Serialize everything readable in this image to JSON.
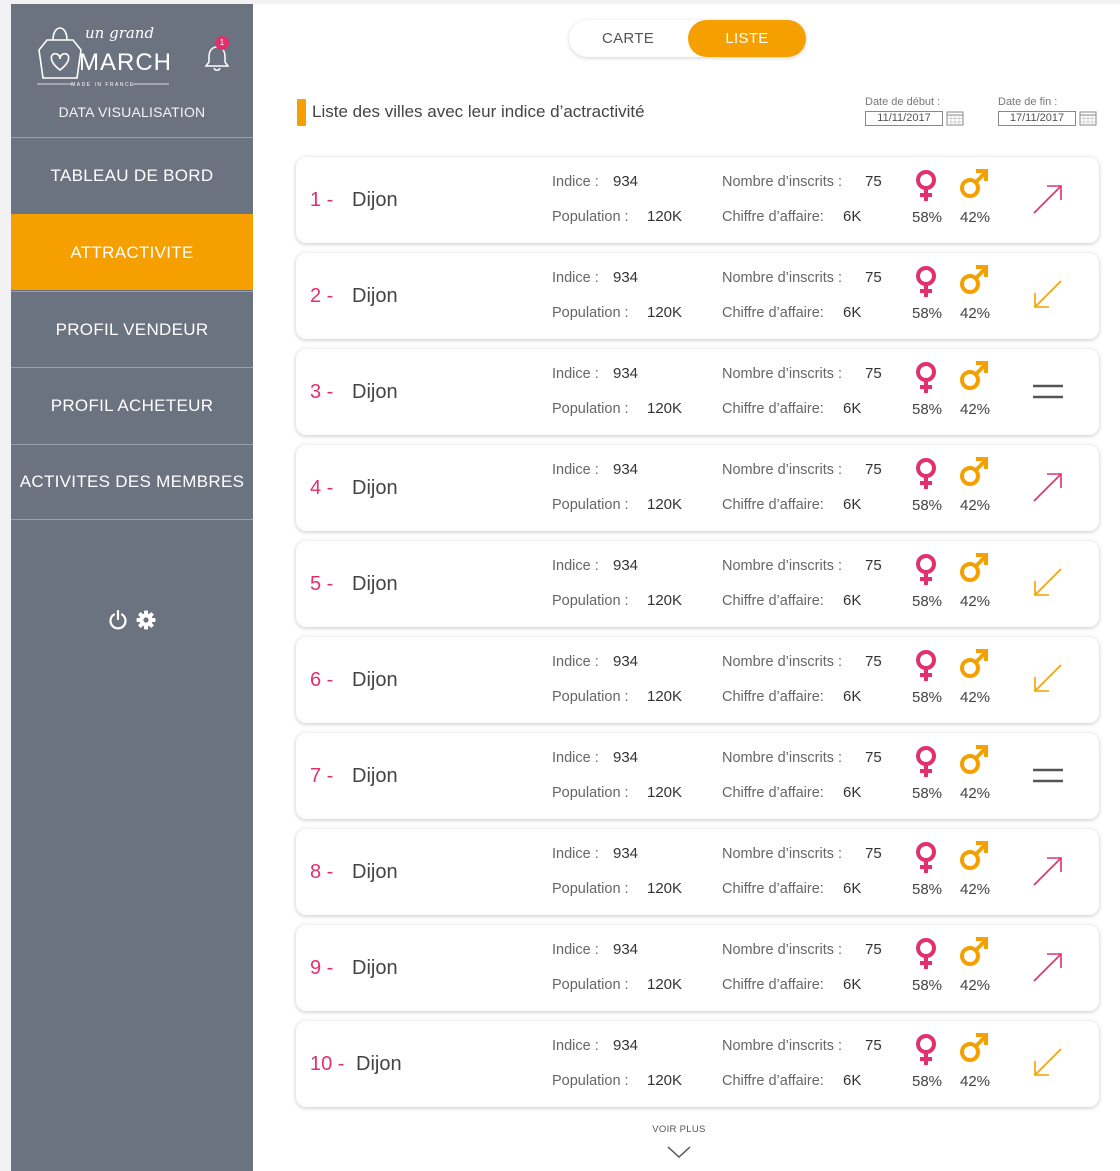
{
  "brand": {
    "line1": "un grand",
    "line2": "MARCHÉ",
    "tagline": "MADE IN FRANCE"
  },
  "notifications": {
    "count": "1"
  },
  "sidebar": {
    "subtitle": "DATA VISUALISATION",
    "items": [
      {
        "label": "TABLEAU DE BORD",
        "active": false
      },
      {
        "label": "ATTRACTIVITE",
        "active": true
      },
      {
        "label": "PROFIL VENDEUR",
        "active": false
      },
      {
        "label": "PROFIL ACHETEUR",
        "active": false
      },
      {
        "label": "ACTIVITES DES MEMBRES",
        "active": false
      }
    ]
  },
  "view_toggle": {
    "carte": "CARTE",
    "liste": "LISTE",
    "selected": "LISTE"
  },
  "section": {
    "title": "Liste des villes avec leur indice d’actractivité"
  },
  "dates": {
    "start_label": "Date de début :",
    "start_value": "11/11/2017",
    "end_label": "Date de fin :",
    "end_value": "17/11/2017"
  },
  "labels": {
    "indice": "Indice :",
    "population": "Population :",
    "inscrits": "Nombre d’inscrits :",
    "ca": "Chiffre d’affaire:"
  },
  "colors": {
    "accent": "#f5a000",
    "female": "#e1306c",
    "male": "#f5a000",
    "sidebar": "#6b7280"
  },
  "cities": [
    {
      "rank": "1 -",
      "name": "Dijon",
      "indice": "934",
      "population": "120K",
      "inscrits": "75",
      "ca": "6K",
      "female": "58%",
      "male": "42%",
      "trend": "up"
    },
    {
      "rank": "2 -",
      "name": "Dijon",
      "indice": "934",
      "population": "120K",
      "inscrits": "75",
      "ca": "6K",
      "female": "58%",
      "male": "42%",
      "trend": "down"
    },
    {
      "rank": "3 -",
      "name": "Dijon",
      "indice": "934",
      "population": "120K",
      "inscrits": "75",
      "ca": "6K",
      "female": "58%",
      "male": "42%",
      "trend": "stable"
    },
    {
      "rank": "4 -",
      "name": "Dijon",
      "indice": "934",
      "population": "120K",
      "inscrits": "75",
      "ca": "6K",
      "female": "58%",
      "male": "42%",
      "trend": "up"
    },
    {
      "rank": "5 -",
      "name": "Dijon",
      "indice": "934",
      "population": "120K",
      "inscrits": "75",
      "ca": "6K",
      "female": "58%",
      "male": "42%",
      "trend": "down"
    },
    {
      "rank": "6 -",
      "name": "Dijon",
      "indice": "934",
      "population": "120K",
      "inscrits": "75",
      "ca": "6K",
      "female": "58%",
      "male": "42%",
      "trend": "down"
    },
    {
      "rank": "7 -",
      "name": "Dijon",
      "indice": "934",
      "population": "120K",
      "inscrits": "75",
      "ca": "6K",
      "female": "58%",
      "male": "42%",
      "trend": "stable"
    },
    {
      "rank": "8 -",
      "name": "Dijon",
      "indice": "934",
      "population": "120K",
      "inscrits": "75",
      "ca": "6K",
      "female": "58%",
      "male": "42%",
      "trend": "up"
    },
    {
      "rank": "9 -",
      "name": "Dijon",
      "indice": "934",
      "population": "120K",
      "inscrits": "75",
      "ca": "6K",
      "female": "58%",
      "male": "42%",
      "trend": "up"
    },
    {
      "rank": "10 -",
      "name": "Dijon",
      "indice": "934",
      "population": "120K",
      "inscrits": "75",
      "ca": "6K",
      "female": "58%",
      "male": "42%",
      "trend": "down"
    }
  ],
  "footer": {
    "voir_plus": "VOIR PLUS"
  }
}
